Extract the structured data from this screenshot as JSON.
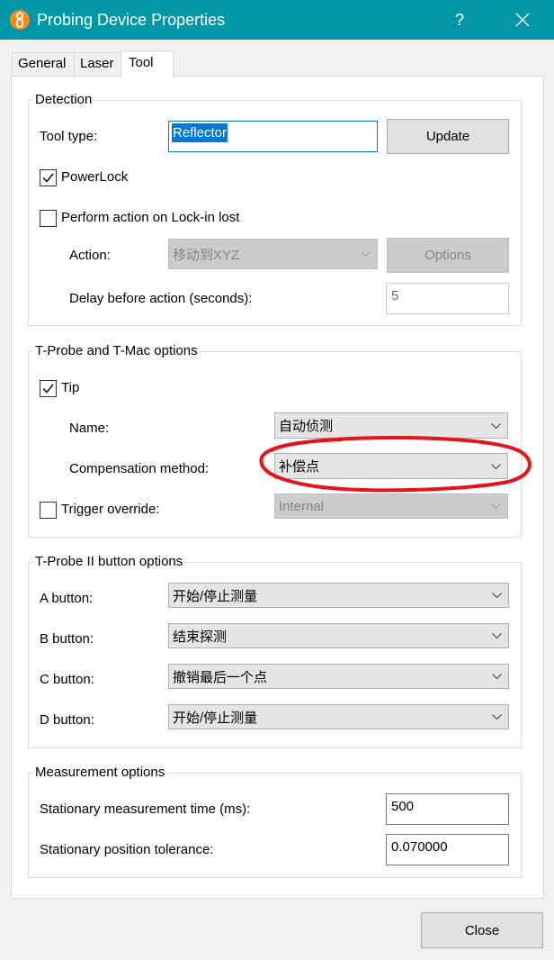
{
  "window": {
    "title": "Probing Device Properties",
    "help_label": "?"
  },
  "icons": {
    "app": "probe-app-icon",
    "close": "close-icon",
    "dropdown": "chevron-down-icon",
    "check": "checkmark-icon"
  },
  "colors": {
    "title_bar": "#0098a6",
    "app_icon": "#f28c1e",
    "selection": "#0078d7",
    "annotation": "#e3141b"
  },
  "tabs": [
    {
      "label": "General",
      "selected": false
    },
    {
      "label": "Laser",
      "selected": false
    },
    {
      "label": "Tool",
      "selected": true
    }
  ],
  "detection": {
    "title": "Detection",
    "tool_type": {
      "label": "Tool type:",
      "value": "Reflector",
      "text_selected": true
    },
    "update_button": {
      "label": "Update"
    },
    "powerlock": {
      "label": "PowerLock",
      "checked": true
    },
    "perform_action": {
      "label": "Perform action on Lock-in lost",
      "checked": false
    },
    "action": {
      "label": "Action:",
      "value": "移动到XYZ",
      "disabled": true
    },
    "options_button": {
      "label": "Options",
      "disabled": true
    },
    "delay": {
      "label": "Delay before action (seconds):",
      "value": "5",
      "disabled": true
    }
  },
  "tprobe_tmac": {
    "title": "T-Probe and T-Mac options",
    "tip": {
      "label": "Tip",
      "checked": true
    },
    "name": {
      "label": "Name:",
      "value": "自动侦测"
    },
    "compensation_method": {
      "label": "Compensation method:",
      "value": "补偿点"
    },
    "trigger_override": {
      "label": "Trigger override:",
      "checked": false,
      "value": "Internal",
      "disabled": true
    }
  },
  "tprobe2_buttons": {
    "title": "T-Probe II button options",
    "buttons": [
      {
        "label": "A button:",
        "value": "开始/停止测量"
      },
      {
        "label": "B button:",
        "value": "结束探测"
      },
      {
        "label": "C button:",
        "value": "撤销最后一个点"
      },
      {
        "label": "D button:",
        "value": "开始/停止测量"
      }
    ]
  },
  "measurement": {
    "title": "Measurement options",
    "stationary_time": {
      "label": "Stationary measurement time (ms):",
      "value": "500"
    },
    "position_tolerance": {
      "label": "Stationary position tolerance:",
      "value": "0.070000"
    }
  },
  "footer": {
    "close_label": "Close"
  }
}
